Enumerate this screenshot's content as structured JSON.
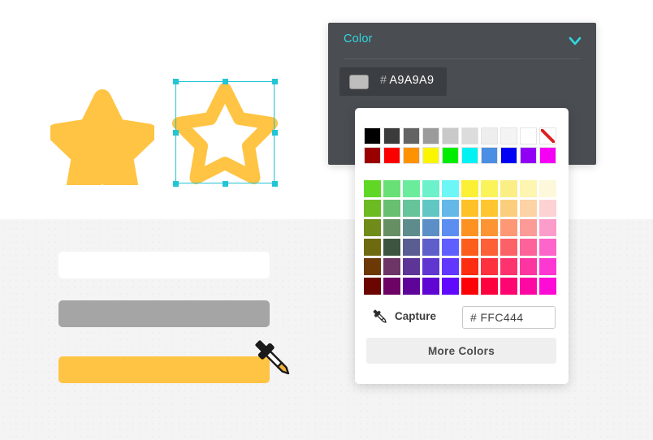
{
  "app": {
    "canvas_bg_top": "#ffffff",
    "canvas_bg_bottom": "#f4f4f4"
  },
  "canvas": {
    "shapes": [
      {
        "name": "star-filled",
        "fill": "#ffc444",
        "selected": false
      },
      {
        "name": "star-outline",
        "stroke": "#ffc444",
        "fill": "#ffffff",
        "selected": true
      }
    ],
    "selection_color": "#22c5d4",
    "bars": [
      {
        "name": "bar-white",
        "color": "#ffffff"
      },
      {
        "name": "bar-gray",
        "color": "#a5a5a5"
      },
      {
        "name": "bar-yellow",
        "color": "#ffc444"
      }
    ],
    "cursor": "eyedropper-cursor"
  },
  "properties_panel": {
    "title": "Color",
    "title_color": "#2fd8e0",
    "background": "#4a4d52",
    "collapse_icon": "chevron-down-icon",
    "current_color": {
      "hash": "#",
      "value": "A9A9A9",
      "swatch": "#bdbdbd"
    }
  },
  "color_picker": {
    "standard_rows": [
      {
        "name": "grayscale-row",
        "colors": [
          "#000000",
          "#3b3b3b",
          "#636363",
          "#9b9b9b",
          "#c9c9c9",
          "#dcdcdc",
          "#eeeeee",
          "#f4f4f4",
          "#ffffff"
        ],
        "last_swatch": "no-color"
      },
      {
        "name": "primary-row",
        "colors": [
          "#9b0000",
          "#fb0000",
          "#ff9200",
          "#fbf500",
          "#00ed00",
          "#00f2f2",
          "#4a8fe3",
          "#0000f5",
          "#9100f5",
          "#f500f5"
        ]
      }
    ],
    "palette_rows": [
      [
        "#5fd724",
        "#68e075",
        "#6bec9d",
        "#6cf1ca",
        "#6cf6f6",
        "#fbf034",
        "#fbf35a",
        "#faee85",
        "#fdf5b0",
        "#fdf8da"
      ],
      [
        "#6dbb22",
        "#68bf6f",
        "#66c49a",
        "#62c7c3",
        "#63b8e8",
        "#ffc128",
        "#ffc62f",
        "#fbce7d",
        "#fdd2a4",
        "#fdd2d2"
      ],
      [
        "#6f8c1a",
        "#678f64",
        "#5e8c8d",
        "#5c8fc5",
        "#5c8df0",
        "#fd9223",
        "#fd9433",
        "#fd9774",
        "#fc9a98",
        "#fc9ccb"
      ],
      [
        "#6d6a10",
        "#3d5441",
        "#5a5d92",
        "#5f5fcb",
        "#5f5fff",
        "#fd5d1b",
        "#fd5f37",
        "#fd6168",
        "#fd6399",
        "#fd65cb"
      ],
      [
        "#6b3806",
        "#6c3565",
        "#5d3596",
        "#5f36cf",
        "#6136fe",
        "#fd2d12",
        "#fd3040",
        "#fd3370",
        "#fd35a0",
        "#fd37d1"
      ],
      [
        "#6a0500",
        "#6c0365",
        "#5f0498",
        "#5f06d3",
        "#6109ff",
        "#fe0008",
        "#fe023f",
        "#fe0572",
        "#fe08a3",
        "#fe0bd5"
      ]
    ],
    "capture": {
      "icon": "eyedropper-icon",
      "label": "Capture",
      "hex_hash": "#",
      "hex_value": "FFC444",
      "hex_placeholder": "# FFC444"
    },
    "more_colors_label": "More Colors"
  }
}
